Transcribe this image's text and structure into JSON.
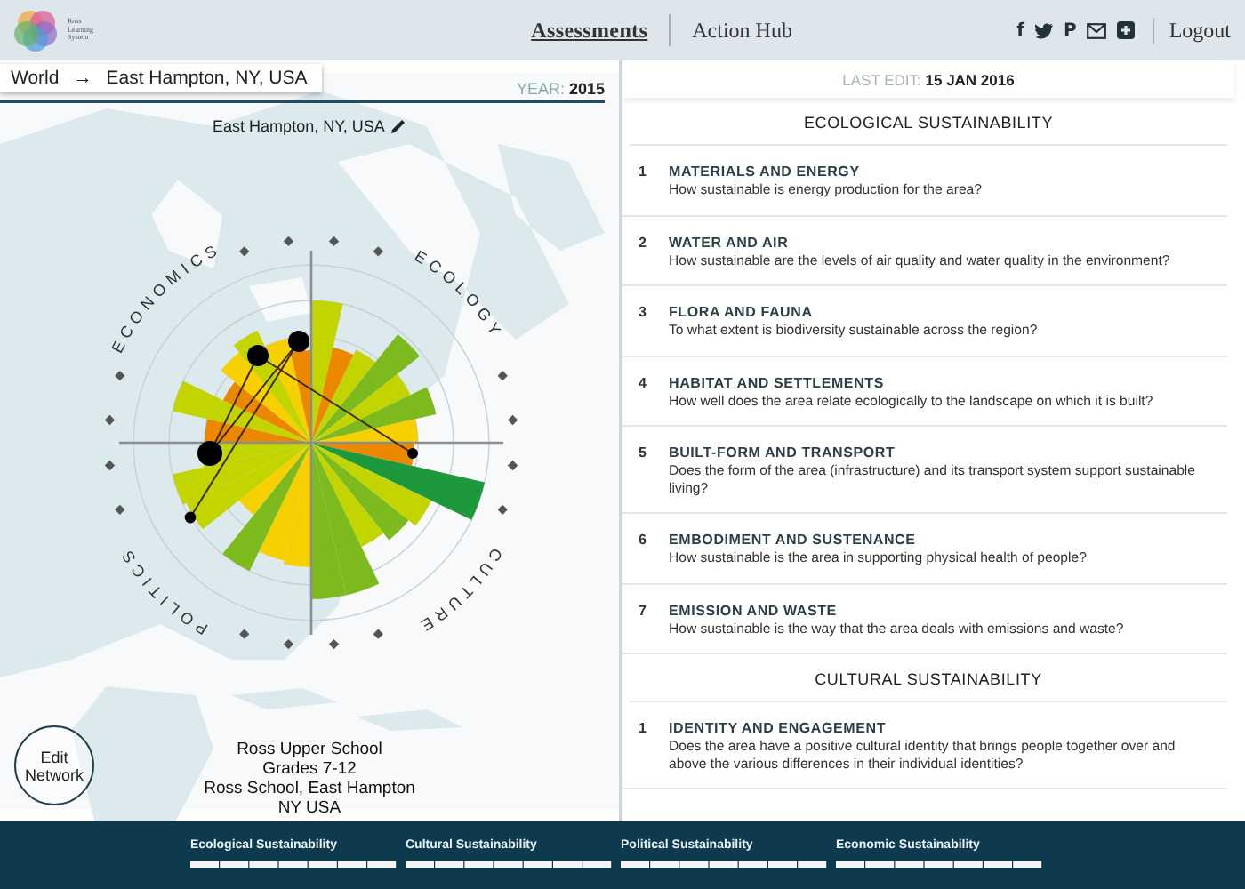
{
  "header": {
    "logo_text": [
      "Ross",
      "Learning",
      "System"
    ],
    "nav": [
      {
        "label": "Assessments",
        "selected": true
      },
      {
        "label": "Action Hub",
        "selected": false
      }
    ],
    "social": [
      {
        "kind": "glyph",
        "text": "f"
      },
      {
        "kind": "bird"
      },
      {
        "kind": "glyph",
        "text": "P"
      },
      {
        "kind": "mail"
      },
      {
        "kind": "plus"
      }
    ],
    "logout": "Logout"
  },
  "map_panel": {
    "breadcrumb": [
      "World",
      "→",
      "East Hampton, NY, USA"
    ],
    "year_label": "YEAR:",
    "year": "2015",
    "location": "East Hampton, NY, USA",
    "axis_labels": [
      "ECONOMICS",
      "ECOLOGY",
      "POLITICS",
      "CULTURE"
    ],
    "school": [
      "Ross Upper School",
      "Grades 7-12",
      "Ross School, East Hampton",
      "NY USA"
    ],
    "edit_button": "Edit Network"
  },
  "question_panel": {
    "last_edit_label": "LAST EDIT:",
    "last_edit": "15 JAN 2016",
    "sections": [
      {
        "title": "ECOLOGICAL SUSTAINABILITY",
        "items": [
          {
            "number": "1",
            "title": "MATERIALS AND ENERGY",
            "question": "How sustainable is energy production for the area?"
          },
          {
            "number": "2",
            "title": "WATER AND AIR",
            "question": "How sustainable are the levels of air quality and water quality in the environment?"
          },
          {
            "number": "3",
            "title": "FLORA AND FAUNA",
            "question": "To what extent is biodiversity sustainable across the region?"
          },
          {
            "number": "4",
            "title": "HABITAT AND SETTLEMENTS",
            "question": "How well does the area relate ecologically to the landscape on which it is built?"
          },
          {
            "number": "5",
            "title": "BUILT-FORM AND TRANSPORT",
            "question": "Does the form of the area (infrastructure) and its transport system support sustainable living?"
          },
          {
            "number": "6",
            "title": "EMBODIMENT AND SUSTENANCE",
            "question": "How sustainable is the area in supporting physical health of people?"
          },
          {
            "number": "7",
            "title": "EMISSION AND WASTE",
            "question": "How sustainable is the way that the area deals with emissions and waste?"
          }
        ]
      },
      {
        "title": "CULTURAL SUSTAINABILITY",
        "items": [
          {
            "number": "1",
            "title": "IDENTITY AND ENGAGEMENT",
            "question": "Does the area have a positive cultural identity that brings people together over and above the various differences in their individual identities?"
          }
        ]
      }
    ]
  },
  "footer": {
    "tracks": [
      "Ecological Sustainability",
      "Cultural Sustainability",
      "Political Sustainability",
      "Economic Sustainability"
    ]
  }
}
